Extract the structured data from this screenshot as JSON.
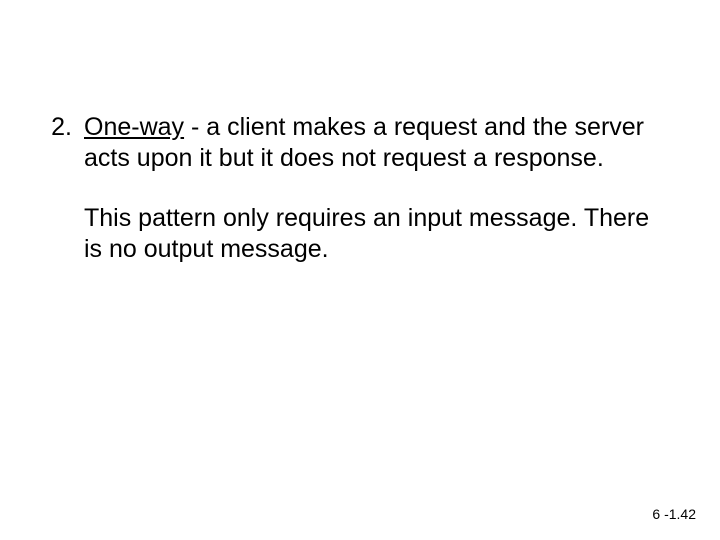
{
  "list": {
    "marker": "2.",
    "term": "One-way",
    "definition_rest": " - a client makes a request and the server acts upon it but it does not request a response.",
    "para2": "This pattern only requires an input message. There is no output message."
  },
  "pageNumber": "6 -1.42"
}
